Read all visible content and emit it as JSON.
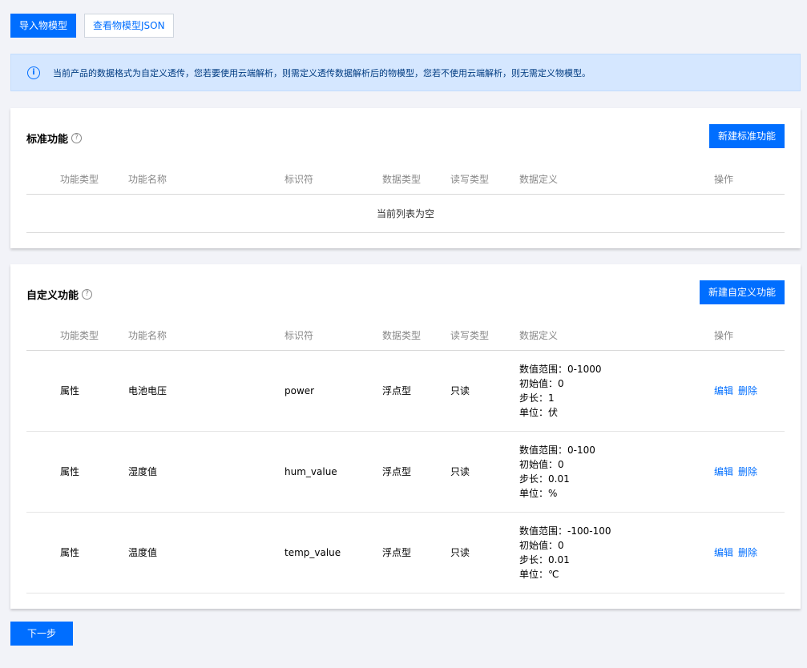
{
  "top_actions": {
    "import_label": "导入物模型",
    "view_json_label": "查看物模型JSON"
  },
  "notice": {
    "icon": "info-icon",
    "text": "当前产品的数据格式为自定义透传，您若要使用云端解析，则需定义透传数据解析后的物模型，您若不使用云端解析，则无需定义物模型。"
  },
  "columns": [
    "功能类型",
    "功能名称",
    "标识符",
    "数据类型",
    "读写类型",
    "数据定义",
    "操作"
  ],
  "standard": {
    "title": "标准功能",
    "add_label": "新建标准功能",
    "empty_text": "当前列表为空"
  },
  "custom": {
    "title": "自定义功能",
    "add_label": "新建自定义功能",
    "rows": [
      {
        "type": "属性",
        "name": "电池电压",
        "identifier": "power",
        "data_type": "浮点型",
        "rw": "只读",
        "def": [
          "数值范围：0-1000",
          "初始值：0",
          "步长：1",
          "单位：伏"
        ],
        "edit": "编辑",
        "delete": "删除"
      },
      {
        "type": "属性",
        "name": "湿度值",
        "identifier": "hum_value",
        "data_type": "浮点型",
        "rw": "只读",
        "def": [
          "数值范围：0-100",
          "初始值：0",
          "步长：0.01",
          "单位：%"
        ],
        "edit": "编辑",
        "delete": "删除"
      },
      {
        "type": "属性",
        "name": "温度值",
        "identifier": "temp_value",
        "data_type": "浮点型",
        "rw": "只读",
        "def": [
          "数值范围：-100-100",
          "初始值：0",
          "步长：0.01",
          "单位：℃"
        ],
        "edit": "编辑",
        "delete": "删除"
      }
    ]
  },
  "next_label": "下一步",
  "colors": {
    "primary": "#006eff",
    "notice_bg": "#d5e7ff",
    "page_bg": "#f2f3f8"
  }
}
